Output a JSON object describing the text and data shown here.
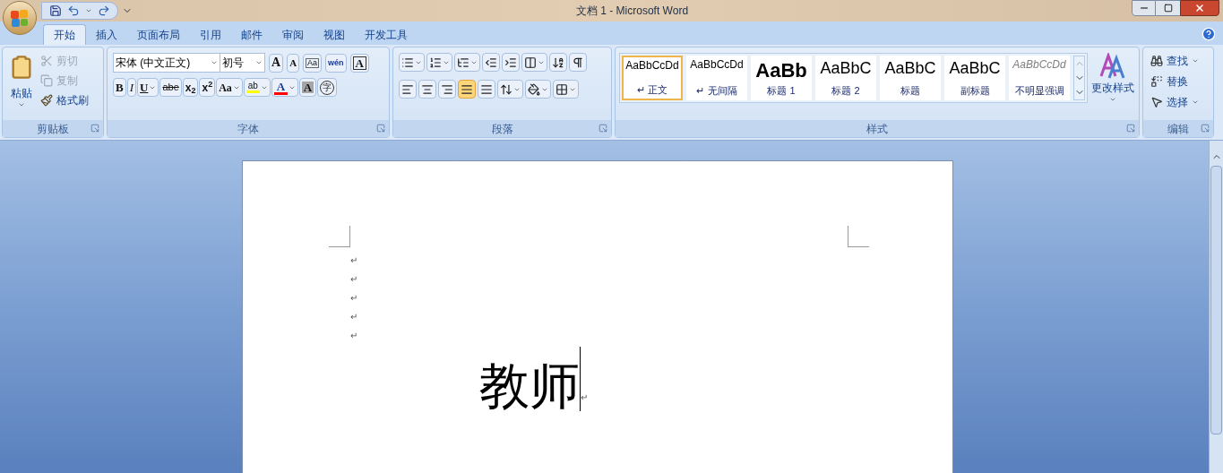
{
  "window": {
    "title": "文档 1 - Microsoft Word"
  },
  "tabs": [
    {
      "label": "开始",
      "selected": true
    },
    {
      "label": "插入",
      "selected": false
    },
    {
      "label": "页面布局",
      "selected": false
    },
    {
      "label": "引用",
      "selected": false
    },
    {
      "label": "邮件",
      "selected": false
    },
    {
      "label": "审阅",
      "selected": false
    },
    {
      "label": "视图",
      "selected": false
    },
    {
      "label": "开发工具",
      "selected": false
    }
  ],
  "clipboard": {
    "label": "剪贴板",
    "paste": "粘贴",
    "items": [
      {
        "kind": "cut",
        "label": "剪切",
        "disabled": true
      },
      {
        "kind": "copy",
        "label": "复制",
        "disabled": true
      },
      {
        "kind": "format_painter",
        "label": "格式刷",
        "disabled": false
      }
    ]
  },
  "font": {
    "label": "字体",
    "font_name": "宋体 (中文正文)",
    "font_size": "初号",
    "row1": [
      {
        "kind": "grow",
        "text": "A"
      },
      {
        "kind": "shrink",
        "text": "A"
      },
      {
        "kind": "clear",
        "text": "Aa"
      },
      {
        "kind": "phonetic",
        "text": "wén"
      },
      {
        "kind": "border",
        "text": "A"
      }
    ],
    "row2": [
      {
        "kind": "bold",
        "text": "B"
      },
      {
        "kind": "italic",
        "text": "I"
      },
      {
        "kind": "underline",
        "text": "U"
      },
      {
        "kind": "strike",
        "text": "abe"
      },
      {
        "kind": "sub",
        "text": "x$_{2}$"
      },
      {
        "kind": "sup",
        "text": "x$^{2}$"
      },
      {
        "kind": "case",
        "text": "Aa"
      },
      {
        "kind": "highlight",
        "text": "ab",
        "color": "#ffff00"
      },
      {
        "kind": "fontcolor",
        "text": "A",
        "color": "#ff0000"
      },
      {
        "kind": "shading",
        "text": "A"
      },
      {
        "kind": "enclose",
        "text": "字"
      }
    ]
  },
  "paragraph": {
    "label": "段落",
    "row1": [
      {
        "kind": "bullets",
        "dropdown": true
      },
      {
        "kind": "numbering",
        "dropdown": true
      },
      {
        "kind": "multilevel",
        "dropdown": true
      },
      {
        "kind": "outdent",
        "dropdown": false
      },
      {
        "kind": "indent",
        "dropdown": false
      },
      {
        "kind": "asian_layout",
        "dropdown": true
      },
      {
        "kind": "sort",
        "dropdown": false
      },
      {
        "kind": "marks",
        "dropdown": false
      }
    ],
    "alignment": [
      {
        "kind": "left",
        "selected": false
      },
      {
        "kind": "center",
        "selected": false
      },
      {
        "kind": "right",
        "selected": false
      },
      {
        "kind": "justify",
        "selected": true
      },
      {
        "kind": "distributed",
        "selected": false
      }
    ],
    "row2": [
      {
        "kind": "spacing",
        "dropdown": true
      },
      {
        "kind": "fill",
        "dropdown": true
      },
      {
        "kind": "borders",
        "dropdown": true
      }
    ]
  },
  "styles": {
    "label": "样式",
    "change_styles": "更改样式",
    "items": [
      {
        "kind": "normal",
        "sample": "AaBbCcDd",
        "name": "正文",
        "mark": "↵",
        "selected": true
      },
      {
        "kind": "normal",
        "sample": "AaBbCcDd",
        "name": "无间隔",
        "mark": "↵",
        "selected": false
      },
      {
        "kind": "heading1",
        "sample": "AaBb",
        "name": "标题 1",
        "selected": false
      },
      {
        "kind": "heading",
        "sample": "AaBbC",
        "name": "标题 2",
        "selected": false
      },
      {
        "kind": "heading",
        "sample": "AaBbC",
        "name": "标题",
        "selected": false
      },
      {
        "kind": "heading",
        "sample": "AaBbC",
        "name": "副标题",
        "selected": false
      },
      {
        "kind": "subtle",
        "sample": "AaBbCcDd",
        "name": "不明显强调",
        "selected": false
      }
    ]
  },
  "editing": {
    "label": "编辑",
    "items": [
      {
        "kind": "find",
        "label": "查找",
        "dropdown": true
      },
      {
        "kind": "replace",
        "label": "替换",
        "dropdown": false
      },
      {
        "kind": "select",
        "label": "选择",
        "dropdown": true
      }
    ]
  },
  "document": {
    "empty_marks": [
      "↵",
      "↵",
      "↵",
      "↵",
      "↵"
    ],
    "text": "教师",
    "end_mark": "↵"
  }
}
